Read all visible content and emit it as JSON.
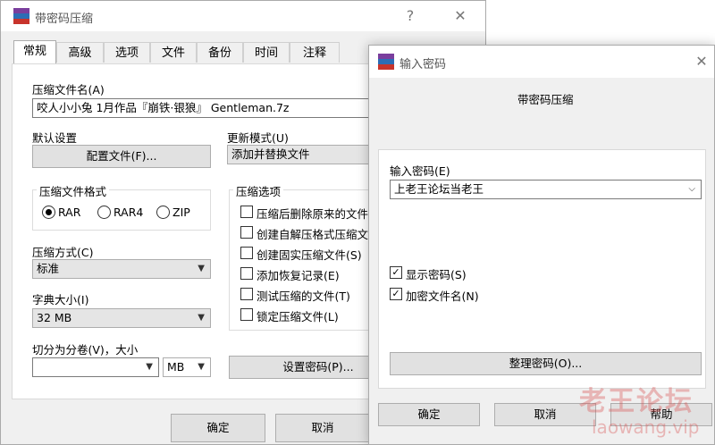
{
  "main": {
    "title": "带密码压缩",
    "help": "?",
    "close": "✕",
    "tabs": [
      "常规",
      "高级",
      "选项",
      "文件",
      "备份",
      "时间",
      "注释"
    ],
    "archive_name_label": "压缩文件名(A)",
    "archive_name": "咬人小小兔 1月作品『崩铁·银狼』 Gentleman.7z",
    "defaults_label": "默认设置",
    "profiles_button": "配置文件(F)...",
    "update_mode_label": "更新模式(U)",
    "update_mode": "添加并替换文件",
    "format_label": "压缩文件格式",
    "format_options": [
      "RAR",
      "RAR4",
      "ZIP"
    ],
    "method_label": "压缩方式(C)",
    "method": "标准",
    "dict_label": "字典大小(I)",
    "dict": "32 MB",
    "split_label": "切分为分卷(V)，大小",
    "split_value": "",
    "split_unit": "MB",
    "options_label": "压缩选项",
    "options": [
      "压缩后删除原来的文件",
      "创建自解压格式压缩文",
      "创建固实压缩文件(S)",
      "添加恢复记录(E)",
      "测试压缩的文件(T)",
      "锁定压缩文件(L)"
    ],
    "set_password_button": "设置密码(P)...",
    "ok": "确定",
    "cancel": "取消"
  },
  "dialog": {
    "title": "输入密码",
    "close": "✕",
    "subtitle": "带密码压缩",
    "password_label": "输入密码(E)",
    "password_value": "上老王论坛当老王",
    "show_password": "显示密码(S)",
    "encrypt_names": "加密文件名(N)",
    "organize_button": "整理密码(O)...",
    "ok": "确定",
    "cancel": "取消",
    "help": "帮助"
  },
  "watermark": {
    "cn": "老王论坛",
    "url": "laowang.vip"
  },
  "colors": {
    "window_bg": "#f0f0f0",
    "watermark": "#d94a4a"
  }
}
